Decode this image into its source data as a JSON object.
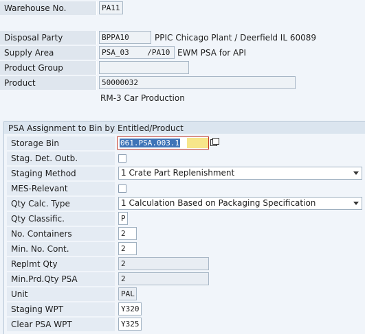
{
  "header": {
    "warehouse_label": "Warehouse No.",
    "warehouse_value": "PA11",
    "disposal_party_label": "Disposal Party",
    "disposal_party_value": "BPPA10",
    "disposal_party_desc": "PPIC Chicago Plant / Deerfield IL 60089",
    "supply_area_label": "Supply Area",
    "supply_area_value": "PSA_03    /PA10",
    "supply_area_desc": "EWM PSA for API",
    "product_group_label": "Product Group",
    "product_group_value": "",
    "product_label": "Product",
    "product_value": "50000032",
    "product_desc": "RM-3 Car Production"
  },
  "section": {
    "title": "PSA Assignment to Bin by Entitled/Product",
    "storage_bin_label": "Storage Bin",
    "storage_bin_value": "061.PSA.003.1",
    "stag_det_label": "Stag. Det. Outb.",
    "staging_method_label": "Staging Method",
    "staging_method_value": "1 Crate Part Replenishment",
    "mes_label": "MES-Relevant",
    "qty_calc_label": "Qty Calc. Type",
    "qty_calc_value": "1 Calculation Based on Packaging Specification",
    "qty_class_label": "Qty Classific.",
    "qty_class_value": "P",
    "no_containers_label": "No. Containers",
    "no_containers_value": "2",
    "min_cont_label": "Min. No. Cont.",
    "min_cont_value": "2",
    "replmt_label": "Replmt Qty",
    "replmt_value": "2",
    "min_prd_label": "Min.Prd.Qty PSA",
    "min_prd_value": "2",
    "unit_label": "Unit",
    "unit_value": "PAL",
    "staging_wpt_label": "Staging WPT",
    "staging_wpt_value": "Y320",
    "clear_wpt_label": "Clear PSA WPT",
    "clear_wpt_value": "Y325"
  },
  "colors": {
    "selection": "#3f74b7",
    "focus_border": "#c0392b",
    "focus_fill": "#f7e68a"
  }
}
